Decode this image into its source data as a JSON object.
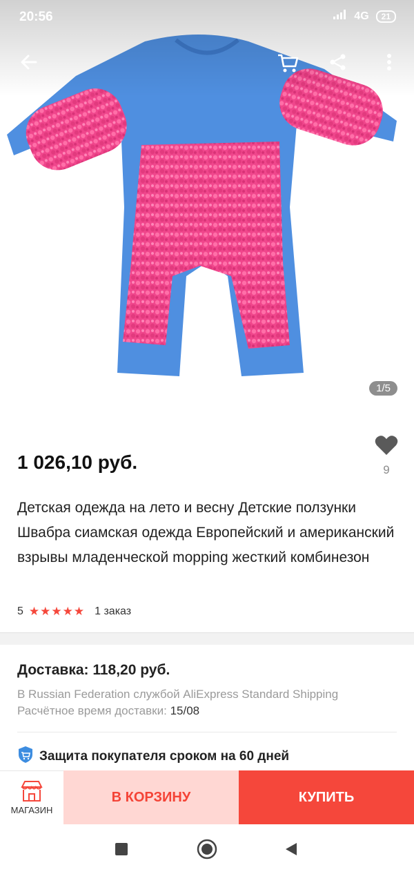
{
  "status_bar": {
    "time": "20:56",
    "network": "4G",
    "battery": "21"
  },
  "image_counter": "1/5",
  "price": "1 026,10 руб.",
  "favorites_count": "9",
  "title": "Детская одежда на лето и весну Детские ползунки Швабра сиамская одежда Европейский и американский взрывы младенческой mopping жесткий комбинезон",
  "rating": {
    "score": "5",
    "stars": "★★★★★",
    "orders": "1 заказ"
  },
  "shipping": {
    "title": "Доставка: 118,20 руб.",
    "service": "В Russian Federation службой AliExpress Standard Shipping",
    "eta_label": "Расчётное время доставки:",
    "eta_value": "15/08"
  },
  "protection": "Защита покупателя сроком на 60 дней",
  "actions": {
    "store_label": "МАГАЗИН",
    "cart_label": "В КОРЗИНУ",
    "buy_label": "КУПИТЬ"
  },
  "colors": {
    "accent": "#f5473b",
    "cart_bg": "#ffd7d3",
    "garment_blue": "#4f8fe0",
    "mop_pink": "#f0468c"
  },
  "icons": [
    "back-arrow-icon",
    "cart-icon",
    "share-icon",
    "more-vertical-icon",
    "heart-icon",
    "shield-icon",
    "store-icon",
    "nav-recent-icon",
    "nav-home-icon",
    "nav-back-icon"
  ]
}
